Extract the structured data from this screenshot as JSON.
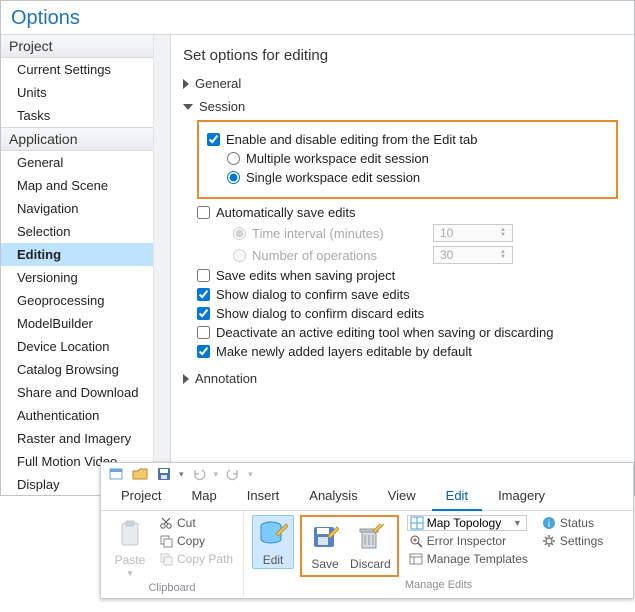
{
  "options": {
    "title": "Options",
    "sidebar": {
      "project": {
        "header": "Project",
        "items": [
          "Current Settings",
          "Units",
          "Tasks"
        ]
      },
      "application": {
        "header": "Application",
        "items": [
          "General",
          "Map and Scene",
          "Navigation",
          "Selection",
          "Editing",
          "Versioning",
          "Geoprocessing",
          "ModelBuilder",
          "Device Location",
          "Catalog Browsing",
          "Share and Download",
          "Authentication",
          "Raster and Imagery",
          "Full Motion Video",
          "Display"
        ],
        "selected": 4
      }
    },
    "content": {
      "title": "Set options for editing",
      "sections": {
        "general": "General",
        "session": "Session",
        "annotation": "Annotation"
      },
      "session": {
        "enable_label": "Enable and disable editing from the Edit tab",
        "multi_label": "Multiple workspace edit session",
        "single_label": "Single workspace edit session",
        "autosave_label": "Automatically save edits",
        "time_label": "Time interval (minutes)",
        "time_value": "10",
        "ops_label": "Number of operations",
        "ops_value": "30",
        "save_project_label": "Save edits when saving project",
        "confirm_save_label": "Show dialog to confirm save edits",
        "confirm_discard_label": "Show dialog to confirm discard edits",
        "deactivate_label": "Deactivate an active editing tool when saving or discarding",
        "editable_layers_label": "Make newly added layers editable by default"
      }
    }
  },
  "ribbon": {
    "tabs": [
      "Project",
      "Map",
      "Insert",
      "Analysis",
      "View",
      "Edit",
      "Imagery"
    ],
    "active_tab": 5,
    "clipboard": {
      "paste": "Paste",
      "cut": "Cut",
      "copy": "Copy",
      "copy_path": "Copy Path",
      "group_label": "Clipboard"
    },
    "manage": {
      "edit": "Edit",
      "save": "Save",
      "discard": "Discard",
      "topology": "Map Topology",
      "error_inspector": "Error Inspector",
      "templates": "Manage Templates",
      "status": "Status",
      "settings": "Settings",
      "group_label": "Manage Edits"
    }
  }
}
